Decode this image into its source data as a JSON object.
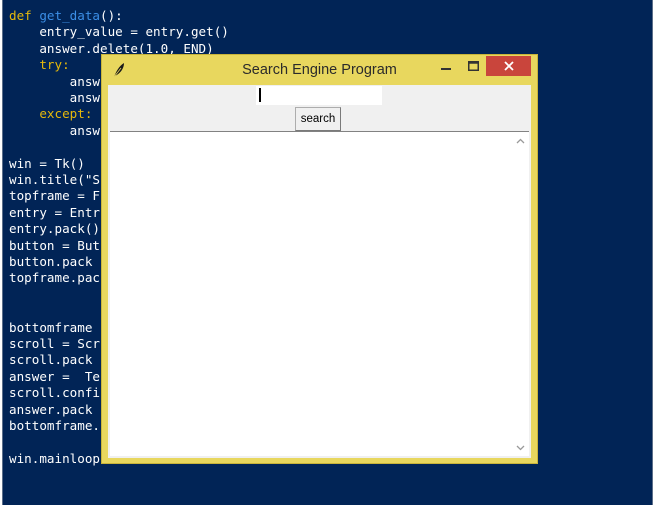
{
  "code_lines": [
    {
      "kind": "def",
      "parts": [
        "def ",
        "get_data",
        "():"
      ]
    },
    {
      "kind": "plain",
      "text": "    entry_value = entry.get()"
    },
    {
      "kind": "plain",
      "text": "    answer.delete(1.0, END)"
    },
    {
      "kind": "kw",
      "text": "    try:"
    },
    {
      "kind": "plain",
      "text": "        answ"
    },
    {
      "kind": "plain",
      "text": "        answ"
    },
    {
      "kind": "kw",
      "text": "    except:"
    },
    {
      "kind": "plain",
      "text": "        answ                                            et connection\""
    },
    {
      "kind": "blank",
      "text": ""
    },
    {
      "kind": "plain",
      "text": "win = Tk()"
    },
    {
      "kind": "plain",
      "text": "win.title(\"S"
    },
    {
      "kind": "plain",
      "text": "topframe = F"
    },
    {
      "kind": "plain",
      "text": "entry = Entr"
    },
    {
      "kind": "plain",
      "text": "entry.pack()"
    },
    {
      "kind": "plain",
      "text": "button = But"
    },
    {
      "kind": "plain",
      "text": "button.pack"
    },
    {
      "kind": "plain",
      "text": "topframe.pac"
    },
    {
      "kind": "blank",
      "text": ""
    },
    {
      "kind": "blank",
      "text": ""
    },
    {
      "kind": "plain",
      "text": "bottomframe"
    },
    {
      "kind": "plain",
      "text": "scroll = Scr"
    },
    {
      "kind": "plain",
      "text": "scroll.pack"
    },
    {
      "kind": "plain",
      "text": "answer =  Te                                        scroll.set, wr"
    },
    {
      "kind": "plain",
      "text": "scroll.confi"
    },
    {
      "kind": "plain",
      "text": "answer.pack"
    },
    {
      "kind": "plain",
      "text": "bottomframe."
    },
    {
      "kind": "blank",
      "text": ""
    },
    {
      "kind": "plain",
      "text": "win.mainloop"
    }
  ],
  "window": {
    "title": "Search Engine Program",
    "button_label": "search",
    "entry_value": "",
    "text_content": ""
  },
  "colors": {
    "editor_bg": "#012456",
    "keyword": "#e5b80b",
    "function_name": "#3b8ee6",
    "window_frame": "#e8d75e",
    "close_button": "#c9453c"
  },
  "icons": [
    "feather-icon",
    "minimize-icon",
    "maximize-icon",
    "close-icon",
    "scroll-up-arrow-icon",
    "scroll-down-arrow-icon"
  ]
}
